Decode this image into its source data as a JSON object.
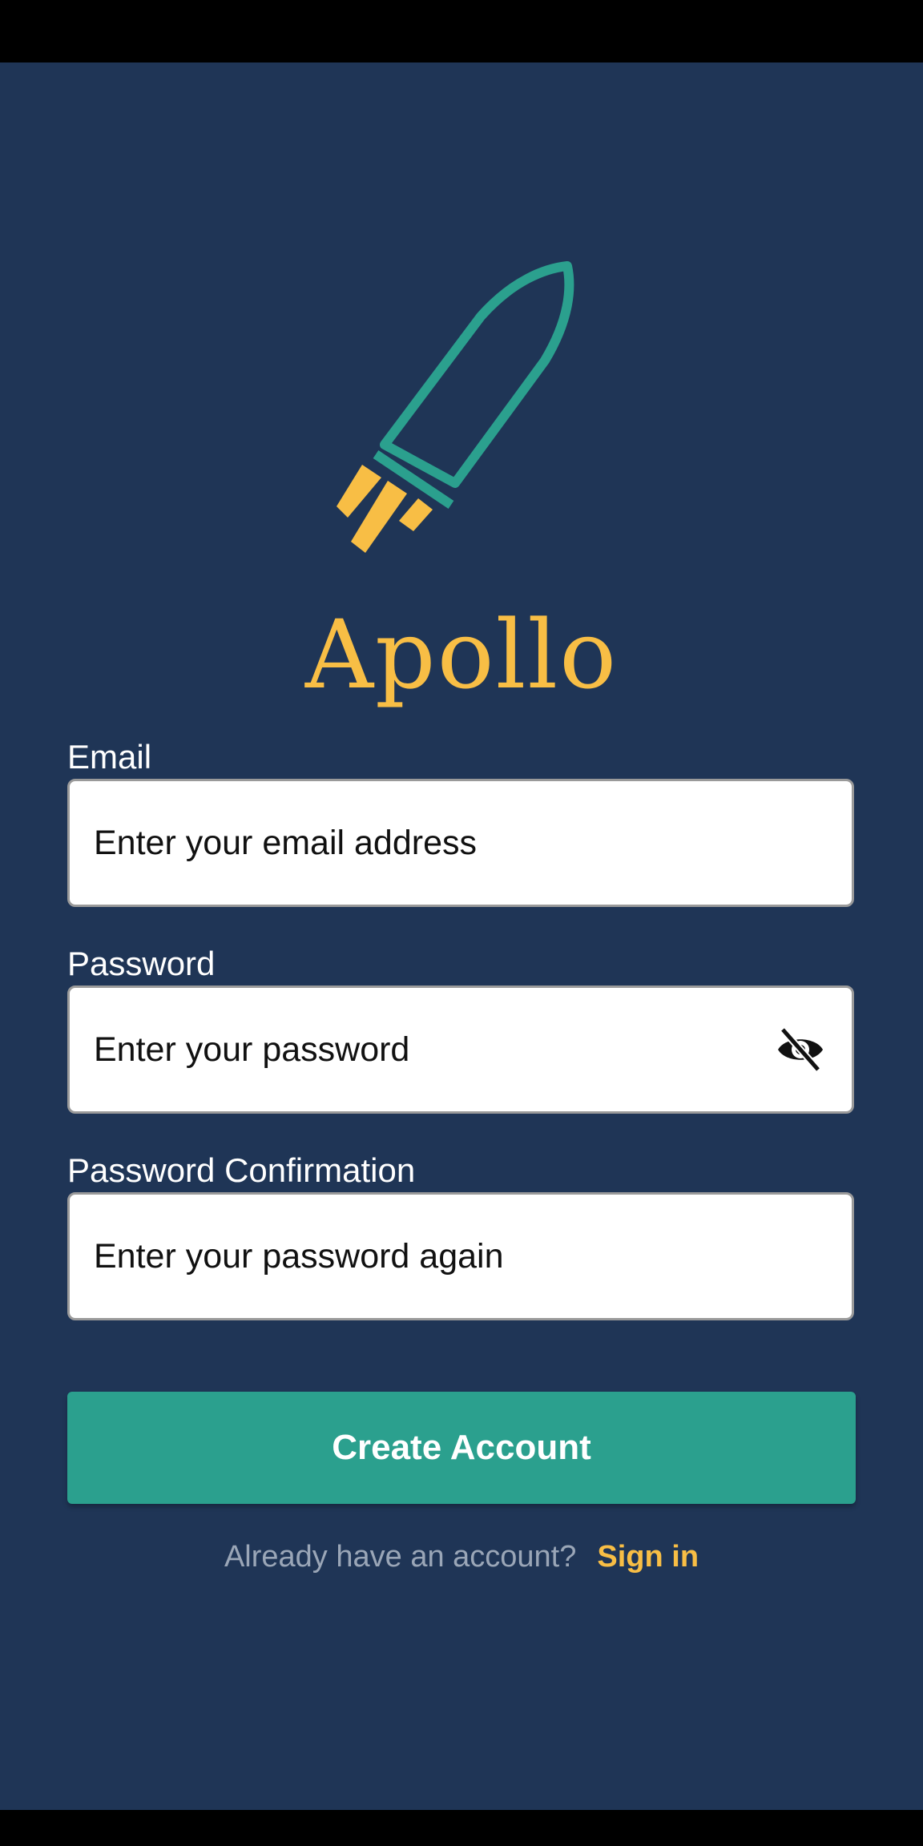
{
  "app": {
    "name": "Apollo",
    "logo_icon": "rocket-icon"
  },
  "colors": {
    "background": "#1f3556",
    "accent_yellow": "#f8be45",
    "accent_teal": "#2ba08e"
  },
  "form": {
    "email": {
      "label": "Email",
      "placeholder": "Enter your email address",
      "value": ""
    },
    "password": {
      "label": "Password",
      "placeholder": "Enter your password",
      "value": "",
      "toggle_icon": "eye-off-icon"
    },
    "password_confirmation": {
      "label": "Password Confirmation",
      "placeholder": "Enter your password again",
      "value": ""
    },
    "submit_label": "Create Account"
  },
  "footer": {
    "prompt": "Already have an account?",
    "link_label": "Sign in"
  }
}
